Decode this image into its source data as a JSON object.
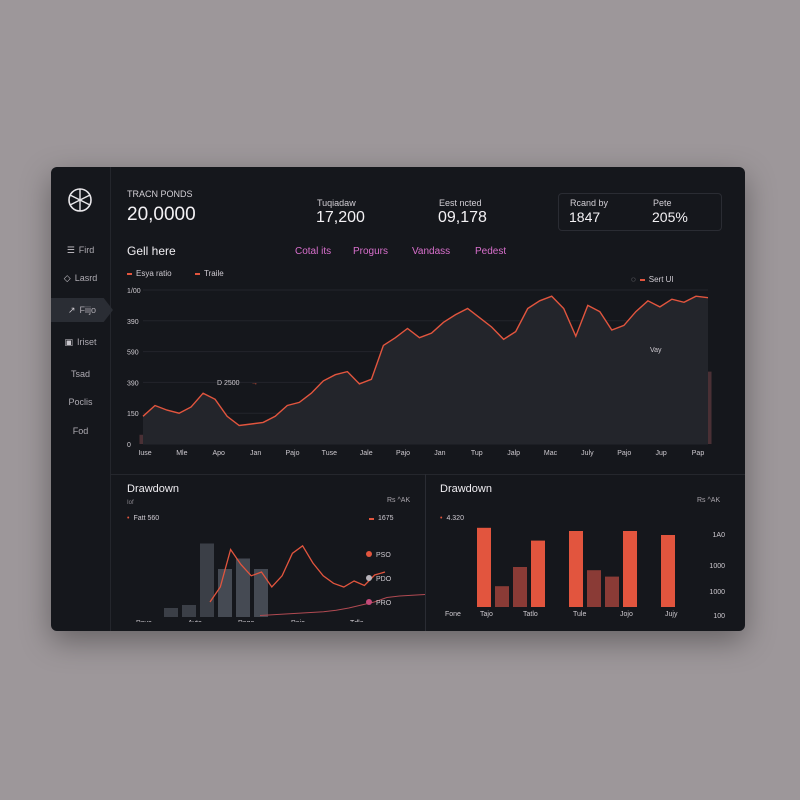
{
  "sidebar": {
    "items": [
      {
        "label": "Fird",
        "icon": "list-icon"
      },
      {
        "label": "Lasrd",
        "icon": "shield-icon"
      },
      {
        "label": "Fiijo",
        "icon": "trend-arrow-icon",
        "active": true
      },
      {
        "label": "Iriset",
        "icon": "document-icon"
      },
      {
        "label": "Tsad",
        "icon": ""
      },
      {
        "label": "Poclis",
        "icon": ""
      },
      {
        "label": "Fod",
        "icon": ""
      }
    ]
  },
  "kpis": [
    {
      "label": "TRACN PONDS",
      "value": "20,0000"
    },
    {
      "label": "Tuqiadaw",
      "value": "17,200"
    },
    {
      "label": "Eest ncted",
      "value": "09,178"
    },
    {
      "label": "Rcand by",
      "value": "1847"
    },
    {
      "label": "Pete",
      "value": "205%"
    }
  ],
  "main": {
    "title": "Gell here",
    "tabs": [
      "Cotal its",
      "Progurs",
      "Vandass",
      "Pedest"
    ],
    "legend": [
      "Esya ratio",
      "Traile"
    ],
    "right_legend": "Sert Ul",
    "annotation": "Vay",
    "callout": "D 2500"
  },
  "bottom_left": {
    "title": "Drawdown",
    "axis_label": "Iof",
    "corner_label": "Rs ^AK",
    "legend_left": "Fatt 560",
    "legend_right": "1675",
    "markers": [
      "PSO",
      "PDO",
      "PRO"
    ]
  },
  "bottom_right": {
    "title": "Drawdown",
    "corner_label": "Rs ^AK",
    "legend_left": "4.320"
  },
  "colors": {
    "accent": "#e2553e",
    "tab": "#d86fcc",
    "bar_dark": "#4a3035",
    "bar_gray": "#3b3f47"
  },
  "chart_data": [
    {
      "type": "line",
      "title": "Gell here",
      "y_ticks": [
        "1/00",
        "390",
        "590",
        "390",
        "150",
        "0"
      ],
      "x_ticks": [
        "Iuse",
        "Mle",
        "Apo",
        "Jan",
        "Pajo",
        "Tuse",
        "Jale",
        "Pajo",
        "Jan",
        "Tup",
        "Jalp",
        "Mac",
        "July",
        "Pajo",
        "Jup",
        "Pap"
      ],
      "ylim": [
        0,
        1000
      ],
      "series": [
        {
          "name": "Esya ratio",
          "values": [
            180,
            250,
            220,
            200,
            240,
            330,
            290,
            180,
            120,
            130,
            140,
            180,
            250,
            270,
            330,
            410,
            450,
            470,
            390,
            420,
            640,
            690,
            750,
            690,
            720,
            790,
            840,
            880,
            820,
            760,
            680,
            730,
            880,
            930,
            960,
            880,
            700,
            900,
            860,
            740,
            770,
            860,
            930,
            890,
            940,
            920,
            960,
            950
          ]
        },
        {
          "name": "Traile",
          "values": [
            60,
            70,
            55,
            80,
            65,
            70,
            60,
            50,
            75,
            60,
            55,
            70,
            80,
            95,
            110,
            120,
            90,
            115,
            100,
            130,
            110,
            95,
            115,
            125,
            105,
            120,
            140,
            110,
            130,
            100,
            115,
            135,
            120,
            140,
            150,
            130,
            115,
            170,
            200,
            250,
            180,
            230,
            280,
            340,
            420,
            520,
            600,
            470
          ]
        }
      ]
    },
    {
      "type": "bar",
      "title": "Drawdown",
      "categories": [
        "Poye",
        "Ayto",
        "Pago",
        "Pajo",
        "Tdle"
      ],
      "ylim": [
        0,
        1000
      ],
      "bars": [
        120,
        160,
        980,
        640,
        780,
        640
      ],
      "series": [
        {
          "name": "1675",
          "values": [
            20,
            40,
            90,
            70,
            55,
            60,
            40,
            55,
            85,
            95,
            72,
            55,
            45,
            40,
            48,
            42,
            56,
            60
          ]
        },
        {
          "name": "",
          "values": [
            2,
            3,
            4,
            5,
            6,
            7,
            9,
            12,
            16,
            20,
            26,
            28,
            29,
            30
          ]
        }
      ]
    },
    {
      "type": "bar",
      "title": "Drawdown",
      "categories": [
        "Fone",
        "Tajo",
        "Tatlo",
        "Tule",
        "Jojo",
        "Jujy"
      ],
      "y_ticks": [
        "1A0",
        "1000",
        "1000",
        "100"
      ],
      "ylim": [
        0,
        1000
      ],
      "values": [
        990,
        260,
        500,
        830,
        950,
        460,
        380,
        950,
        900
      ]
    }
  ]
}
